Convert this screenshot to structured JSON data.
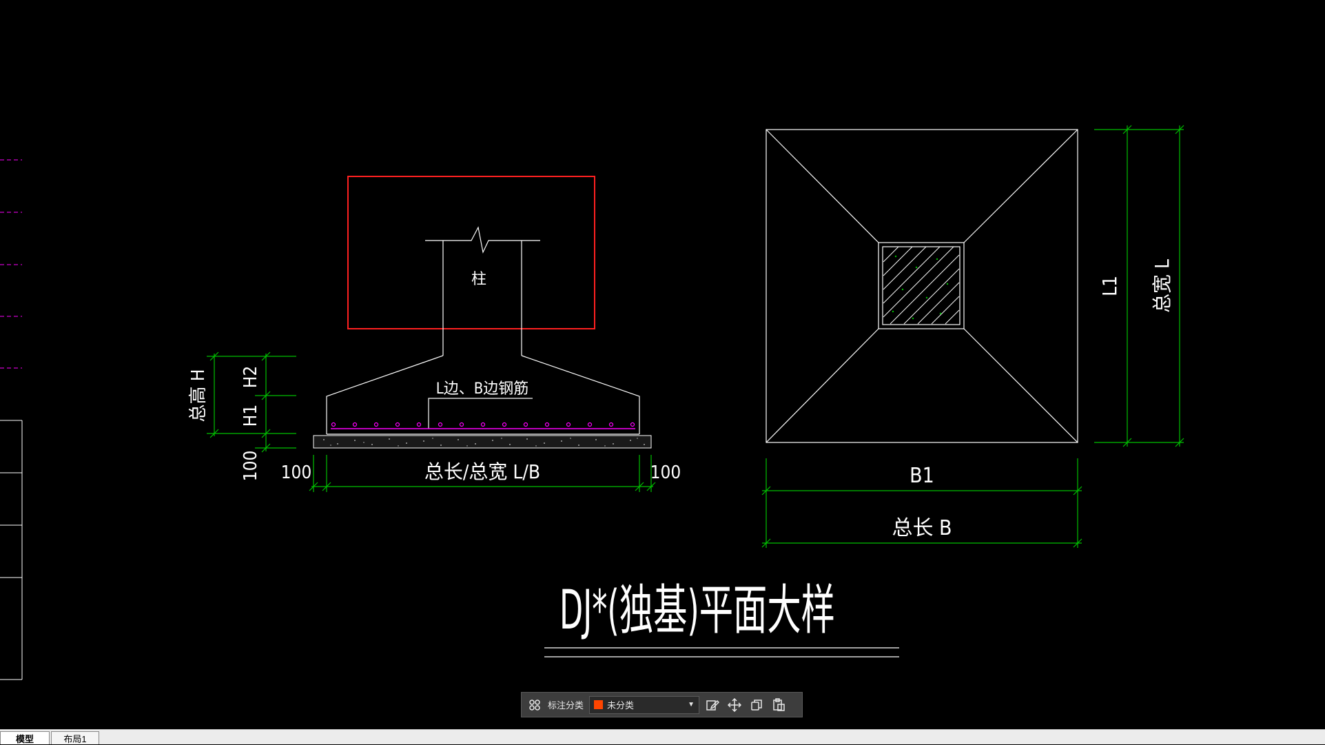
{
  "drawing": {
    "title": "DJ*(独基)平面大样",
    "section": {
      "column_label": "柱",
      "rebar_label": "L边、B边钢筋",
      "total_height": "总高 H",
      "h2": "H2",
      "h1": "H1",
      "cushion": "100",
      "left_offset": "100",
      "right_offset": "100",
      "length_label": "总长/总宽  L/B"
    },
    "plan": {
      "b1": "B1",
      "total_b": "总长 B",
      "l1": "L1",
      "total_l": "总宽 L"
    }
  },
  "toolbar": {
    "label": "标注分类",
    "selected": "未分类",
    "swatch_color": "#ff4500"
  },
  "tabs": [
    {
      "label": "模型"
    },
    {
      "label": "布局1"
    }
  ],
  "colors": {
    "background": "#000000",
    "line": "#ffffff",
    "dimension": "#00c000",
    "highlight": "#ff2020",
    "rebar": "#ff00ff"
  }
}
